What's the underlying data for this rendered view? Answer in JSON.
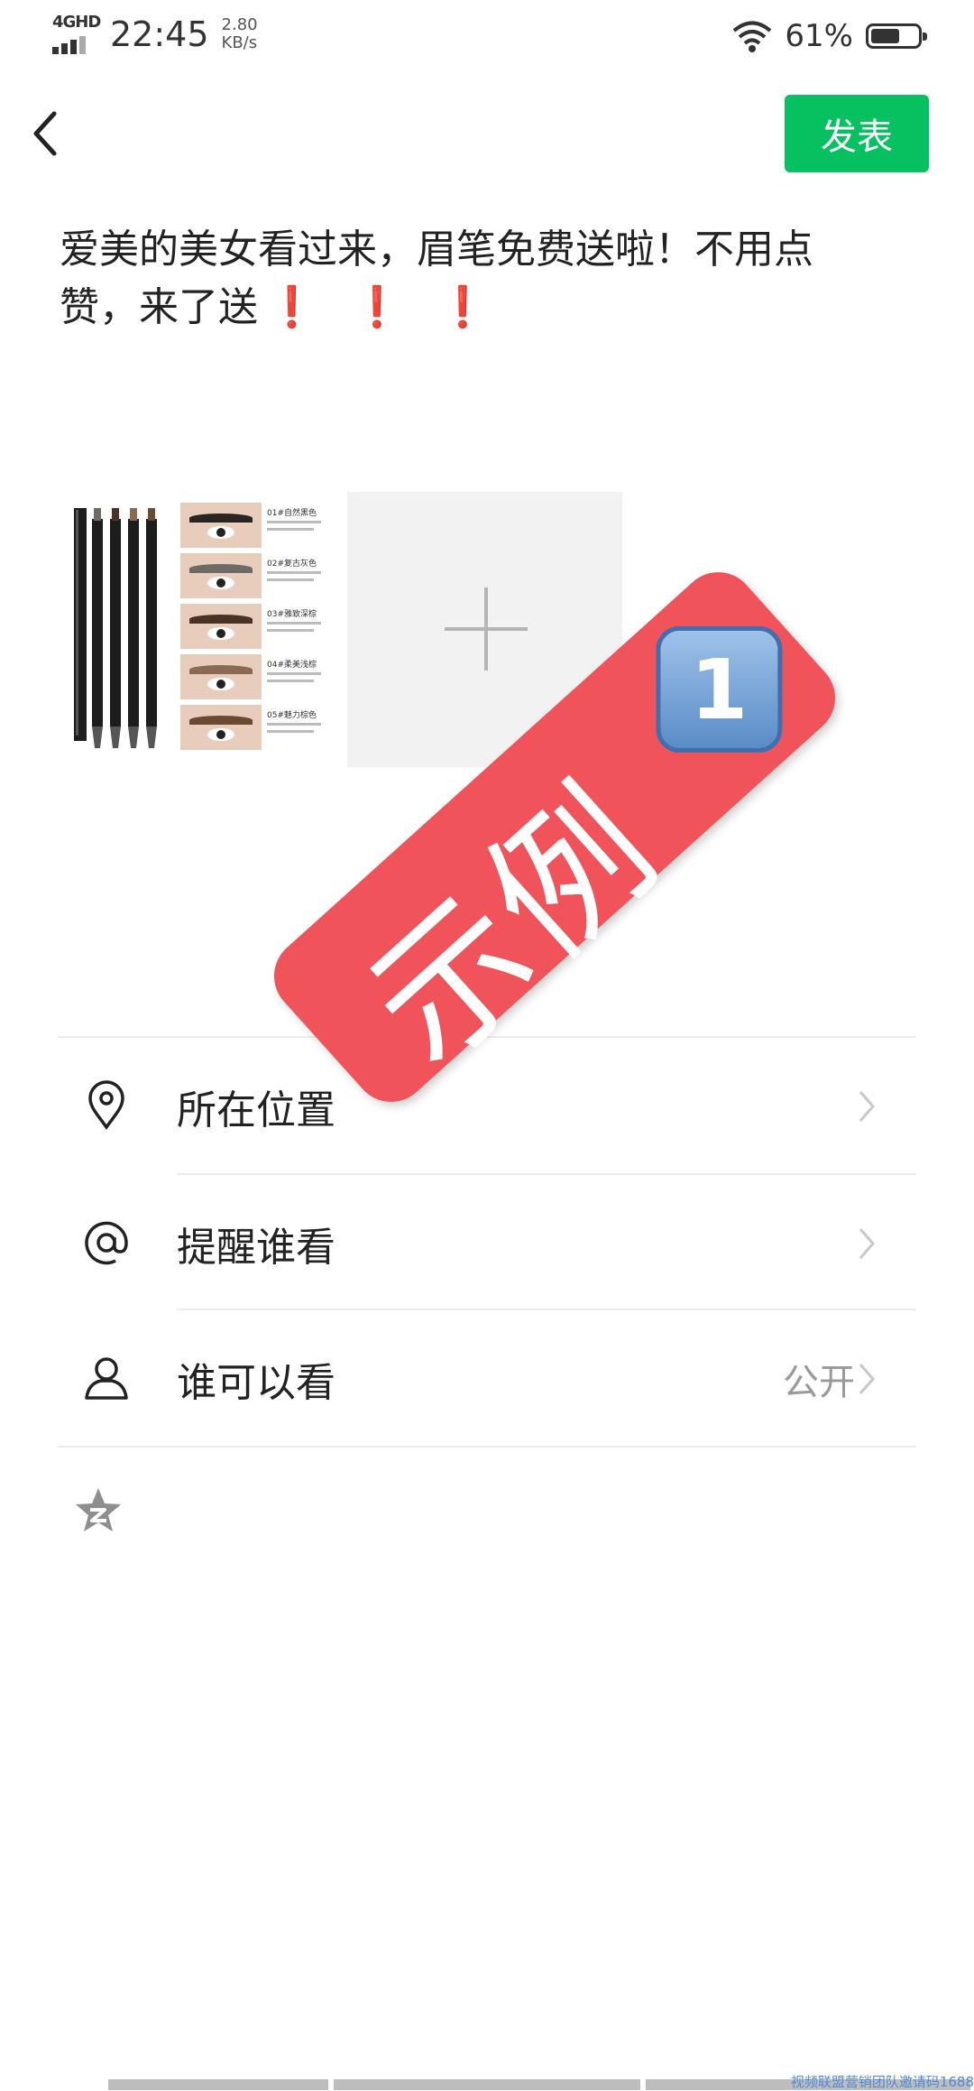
{
  "status_bar": {
    "network": "4GHD",
    "time": "22:45",
    "speed_value": "2.80",
    "speed_unit": "KB/s",
    "battery_percent": "61%",
    "battery_level": 0.61
  },
  "header": {
    "publish_label": "发表"
  },
  "post": {
    "text_line1": "爱美的美女看过来，眉笔免费送啦！不用点",
    "text_line2": "赞，来了送",
    "exclamation": "❗"
  },
  "images": {
    "thumbnail_label": "eyebrow-pencil-product",
    "swatch_labels": [
      "01#自然黑色",
      "02#复古灰色",
      "03#雅致深棕",
      "04#柔美浅棕",
      "05#魅力棕色"
    ],
    "swatch_colors": [
      "#2a2522",
      "#6e6a66",
      "#4a3326",
      "#8a6a52",
      "#6b4a33"
    ],
    "add_tile": "add-photo"
  },
  "watermark": {
    "text": "示例",
    "number": "1"
  },
  "options": [
    {
      "label": "所在位置",
      "value": "",
      "icon": "location-pin-icon"
    },
    {
      "label": "提醒谁看",
      "value": "",
      "icon": "at-sign-icon"
    },
    {
      "label": "谁可以看",
      "value": "公开",
      "icon": "person-icon"
    }
  ],
  "footer": {
    "note": "视频联盟营销团队邀请码1688"
  },
  "colors": {
    "accent": "#07c160",
    "stamp": "#f0545a",
    "link": "#4f8ad6"
  }
}
